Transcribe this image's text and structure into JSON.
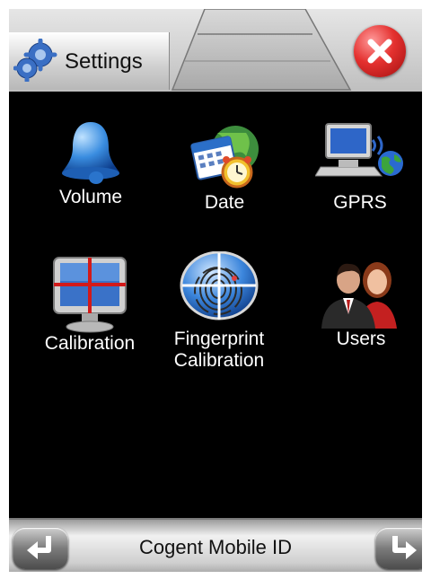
{
  "header": {
    "title": "Settings"
  },
  "items": [
    {
      "label": "Volume",
      "icon": "bell-icon"
    },
    {
      "label": "Date",
      "icon": "calendar-clock-icon"
    },
    {
      "label": "GPRS",
      "icon": "computer-globe-icon"
    },
    {
      "label": "Calibration",
      "icon": "monitor-crosshair-icon"
    },
    {
      "label_line1": "Fingerprint",
      "label_line2": "Calibration",
      "icon": "fingerprint-crosshair-icon"
    },
    {
      "label": "Users",
      "icon": "users-icon"
    }
  ],
  "footer": {
    "title": "Cogent Mobile ID"
  },
  "colors": {
    "background": "#000000",
    "accent_blue": "#2e7fd8",
    "close_red": "#e4312f"
  }
}
